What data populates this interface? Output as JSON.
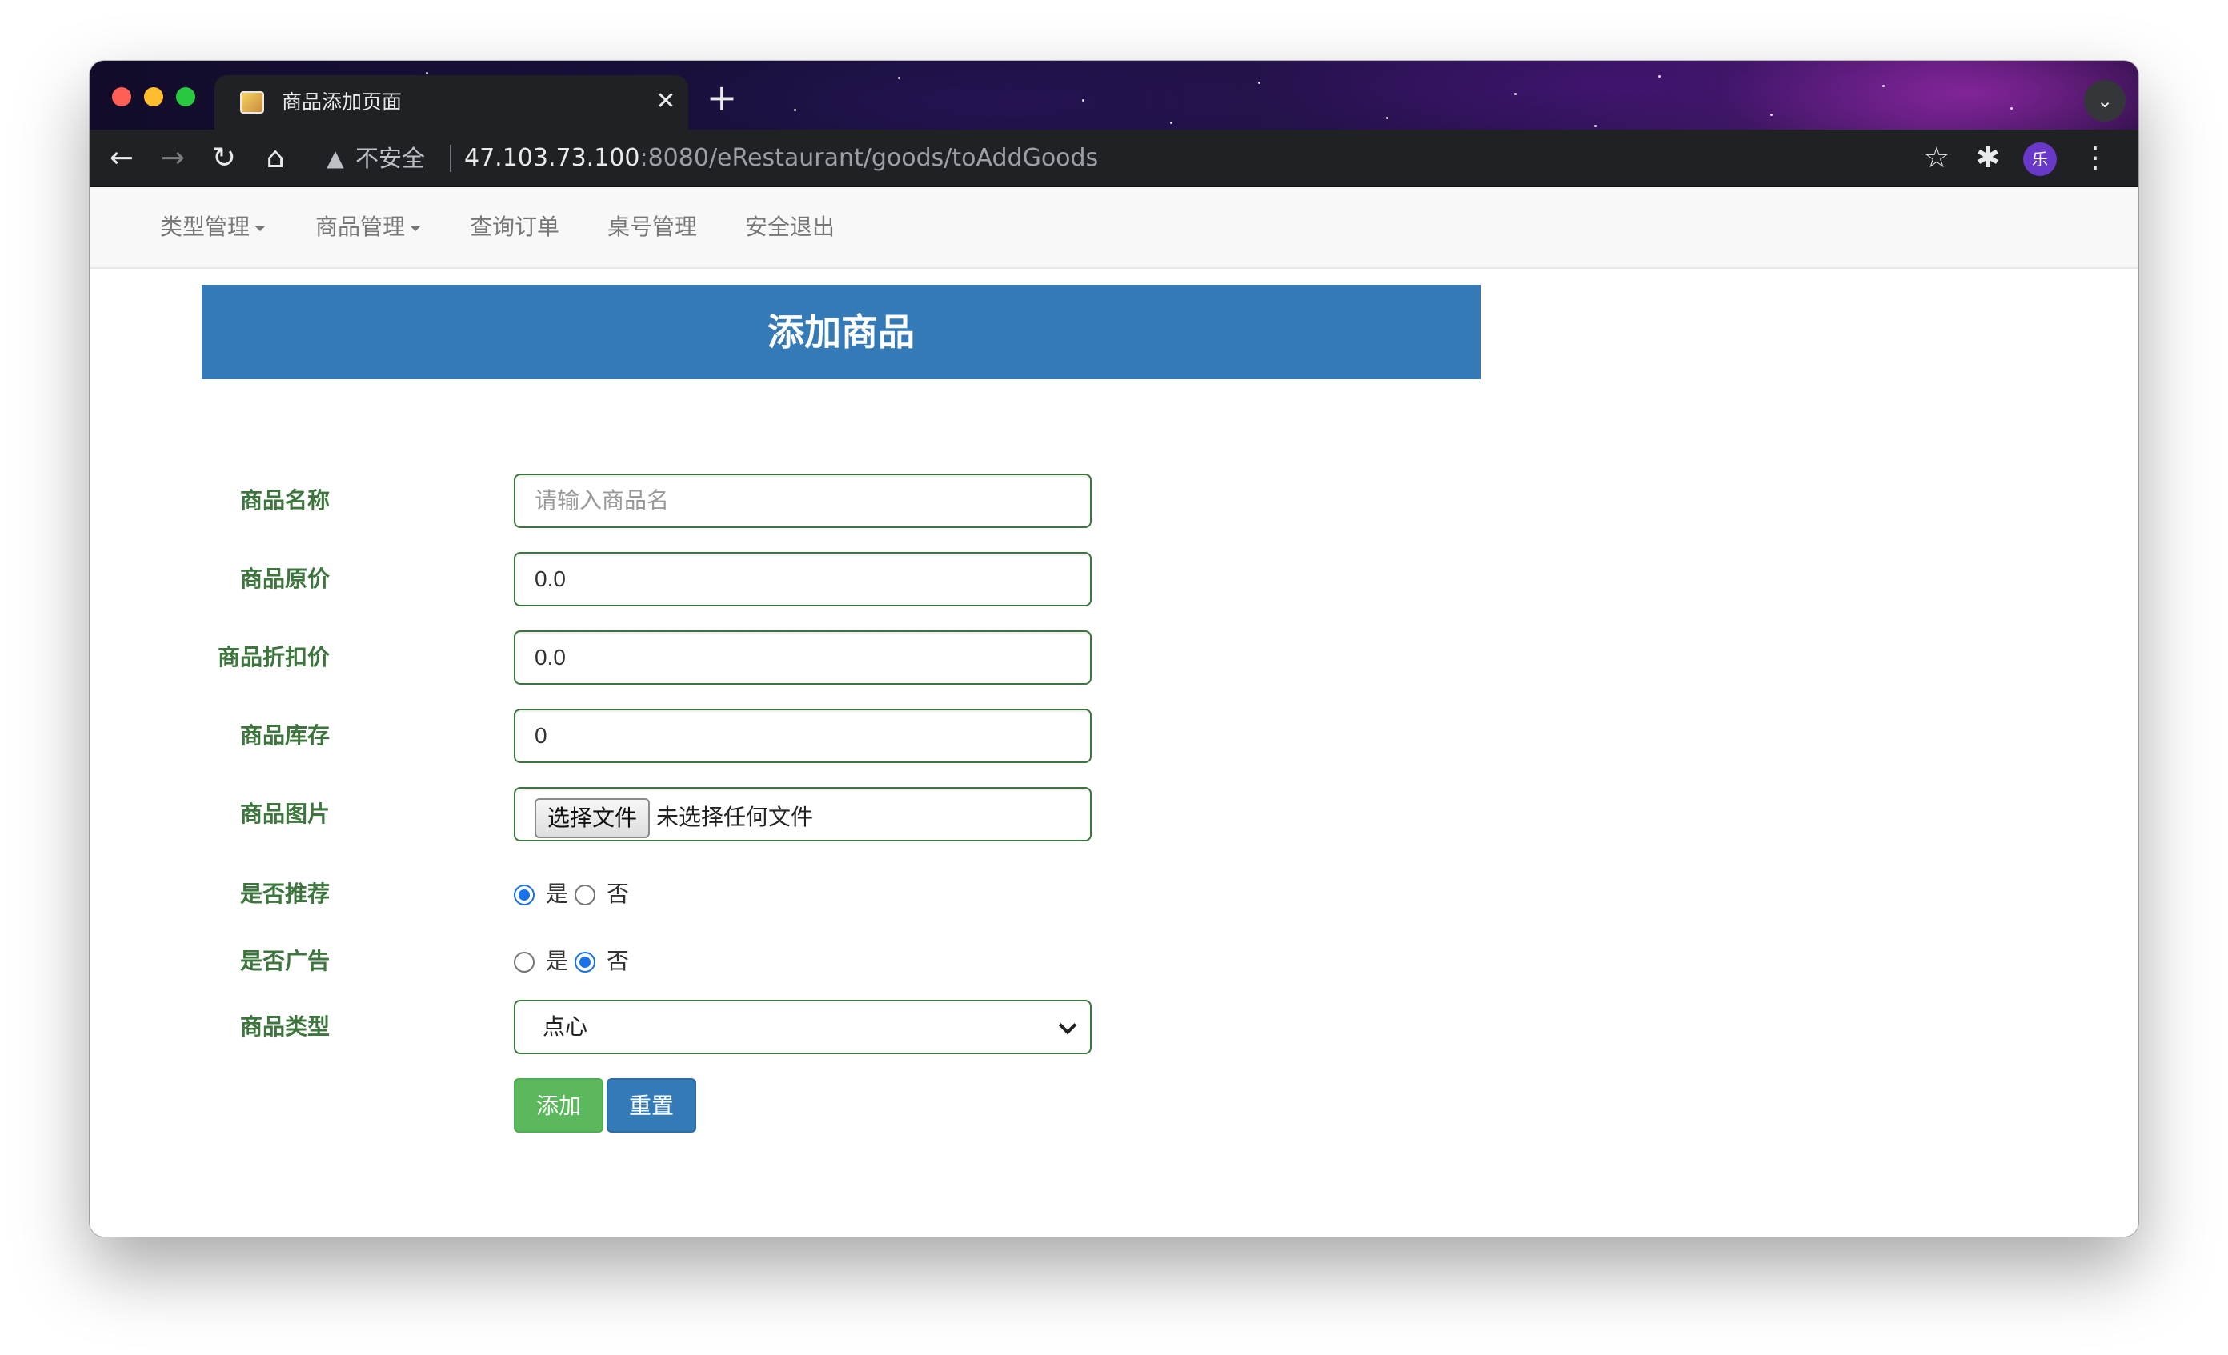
{
  "browser": {
    "tab_title": "商品添加页面",
    "tab_close": "✕",
    "new_tab": "+",
    "security_label": "不安全",
    "url_host": "47.103.73.100",
    "url_rest": ":8080/eRestaurant/goods/toAddGoods",
    "profile_initial": "乐"
  },
  "nav": {
    "items": [
      {
        "label": "类型管理",
        "dropdown": true
      },
      {
        "label": "商品管理",
        "dropdown": true
      },
      {
        "label": "查询订单",
        "dropdown": false
      },
      {
        "label": "桌号管理",
        "dropdown": false
      },
      {
        "label": "安全退出",
        "dropdown": false
      }
    ]
  },
  "form": {
    "title": "添加商品",
    "name": {
      "label": "商品名称",
      "placeholder": "请输入商品名",
      "value": ""
    },
    "price": {
      "label": "商品原价",
      "value": "0.0"
    },
    "discount": {
      "label": "商品折扣价",
      "value": "0.0"
    },
    "stock": {
      "label": "商品库存",
      "value": "0"
    },
    "image": {
      "label": "商品图片",
      "button": "选择文件",
      "status": "未选择任何文件"
    },
    "recommend": {
      "label": "是否推荐",
      "yes": "是",
      "no": "否",
      "selected": "是"
    },
    "advert": {
      "label": "是否广告",
      "yes": "是",
      "no": "否",
      "selected": "否"
    },
    "type": {
      "label": "商品类型",
      "selected": "点心"
    },
    "add_button": "添加",
    "reset_button": "重置"
  },
  "colors": {
    "label_green": "#3c763d",
    "banner_blue": "#337ab7",
    "add_green": "#5cb85c",
    "radio_blue": "#1a73e8"
  }
}
